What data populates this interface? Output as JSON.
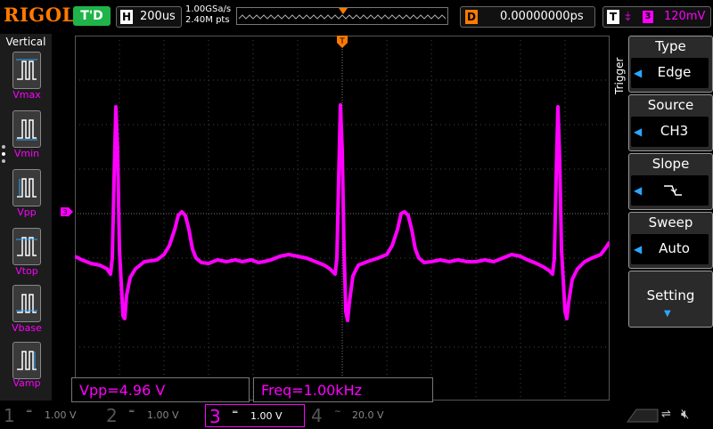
{
  "top": {
    "logo": "RIGOL",
    "run_state": "T'D",
    "timebase_key": "H",
    "timebase": "200us",
    "sample_rate": "1.00GSa/s",
    "memory_depth": "2.40M pts",
    "delay_key": "D",
    "delay": "0.00000000ps",
    "trigger_key": "T",
    "trigger_channel": "3",
    "trigger_level": "120mV"
  },
  "measure_panel": {
    "title": "Vertical",
    "items": [
      "Vmax",
      "Vmin",
      "Vpp",
      "Vtop",
      "Vbase",
      "Vamp"
    ]
  },
  "trigger_menu": {
    "label": "Trigger",
    "items": [
      {
        "title": "Type",
        "value": "Edge"
      },
      {
        "title": "Source",
        "value": "CH3"
      },
      {
        "title": "Slope",
        "value": ""
      },
      {
        "title": "Sweep",
        "value": "Auto"
      },
      {
        "title": "Setting",
        "value": ""
      }
    ]
  },
  "measurements": {
    "vpp": "Vpp=4.96 V",
    "freq": "Freq=1.00kHz"
  },
  "channels": [
    {
      "num": "1",
      "coupling": "═",
      "scale": "1.00 V"
    },
    {
      "num": "2",
      "coupling": "═",
      "scale": "1.00 V"
    },
    {
      "num": "3",
      "coupling": "═",
      "scale": "1.00 V"
    },
    {
      "num": "4",
      "coupling": "~",
      "scale": "20.0 V"
    }
  ],
  "markers": {
    "ch3_ground": "3",
    "trigger_top": "T"
  },
  "colors": {
    "ch3": "#ff00ff",
    "accent": "#ff7a00",
    "run": "#1fb34a",
    "menu_arrow": "#2aa7ff"
  }
}
